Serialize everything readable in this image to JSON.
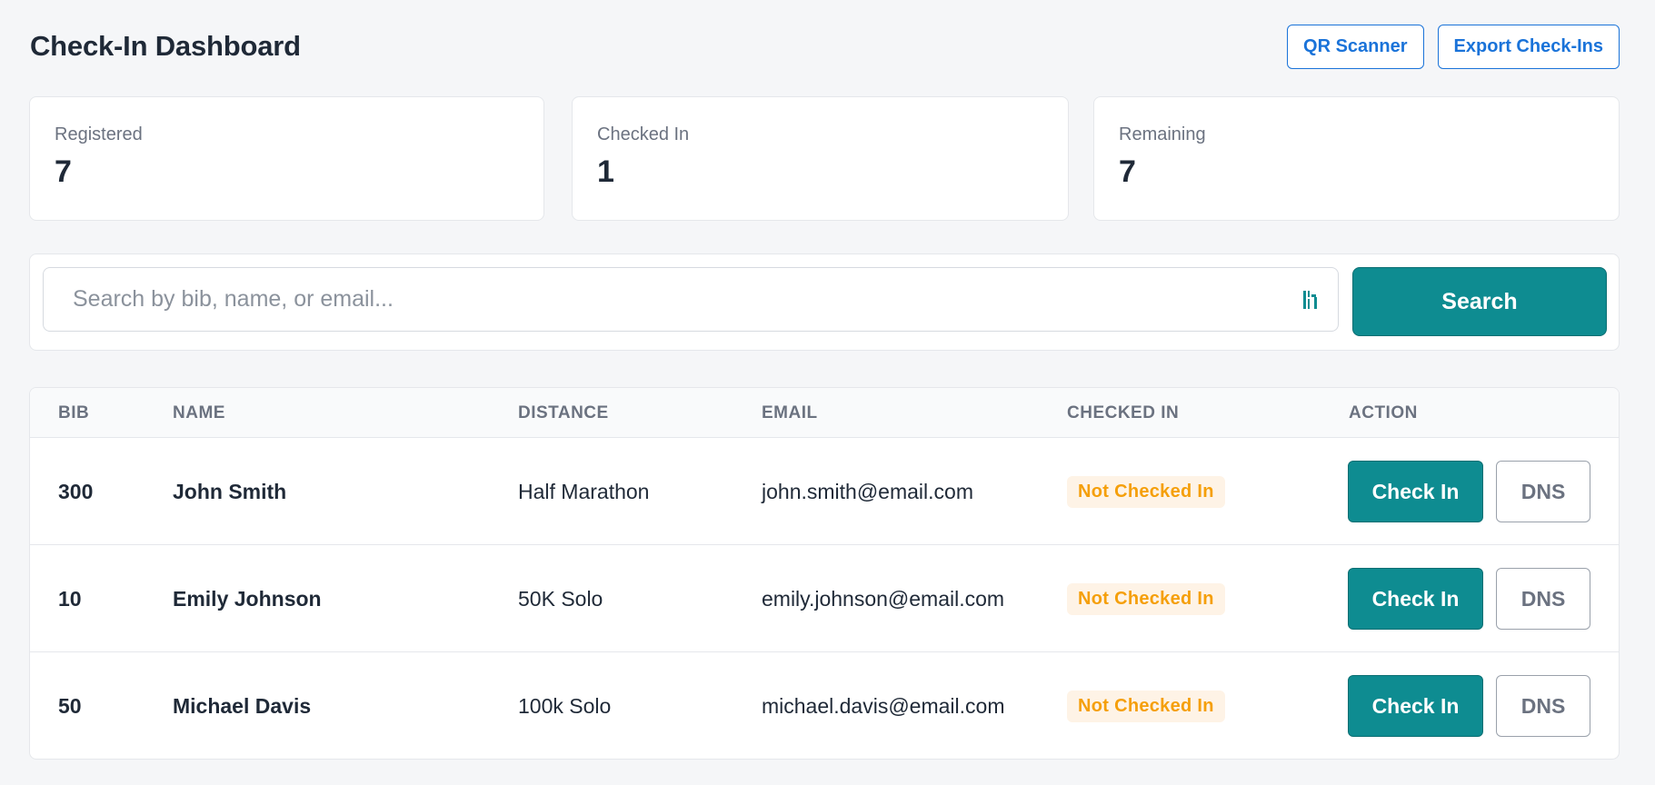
{
  "header": {
    "title": "Check-In Dashboard",
    "qr_scanner_label": "QR Scanner",
    "export_label": "Export Check-Ins"
  },
  "stats": [
    {
      "label": "Registered",
      "value": "7"
    },
    {
      "label": "Checked In",
      "value": "1"
    },
    {
      "label": "Remaining",
      "value": "7"
    }
  ],
  "search": {
    "placeholder": "Search by bib, name, or email...",
    "value": "",
    "scan_icon": "barcode-scan-icon",
    "button_label": "Search"
  },
  "table": {
    "columns": [
      "BIB",
      "NAME",
      "DISTANCE",
      "EMAIL",
      "CHECKED IN",
      "ACTION"
    ],
    "rows": [
      {
        "bib": "300",
        "name": "John Smith",
        "distance": "Half Marathon",
        "email": "john.smith@email.com",
        "status": "Not Checked In",
        "checkin_label": "Check In",
        "dns_label": "DNS"
      },
      {
        "bib": "10",
        "name": "Emily Johnson",
        "distance": "50K Solo",
        "email": "emily.johnson@email.com",
        "status": "Not Checked In",
        "checkin_label": "Check In",
        "dns_label": "DNS"
      },
      {
        "bib": "50",
        "name": "Michael Davis",
        "distance": "100k Solo",
        "email": "michael.davis@email.com",
        "status": "Not Checked In",
        "checkin_label": "Check In",
        "dns_label": "DNS"
      }
    ]
  },
  "colors": {
    "accent": "#0e8c91",
    "link_blue": "#1a73d9",
    "status_pending_text": "#f59f0a",
    "status_pending_bg": "#fef3e6",
    "page_bg": "#f5f6f8"
  }
}
